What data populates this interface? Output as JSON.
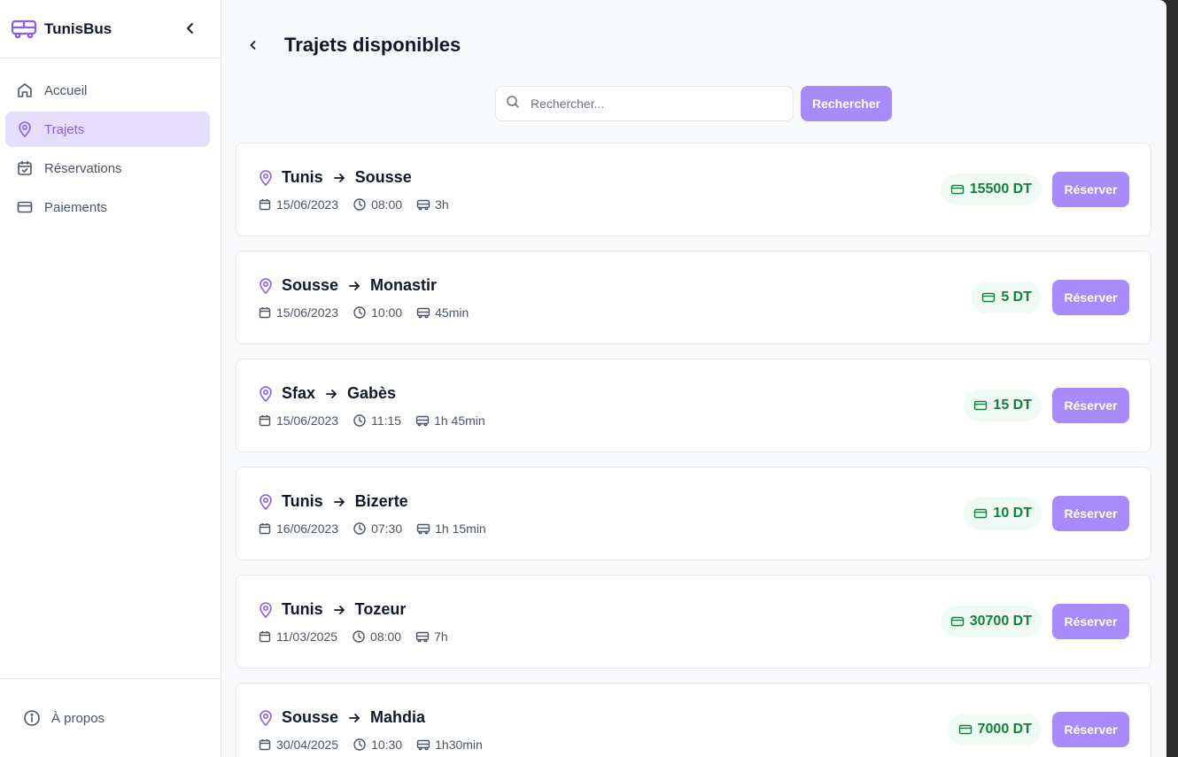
{
  "app": {
    "name": "TunisBus"
  },
  "sidebar": {
    "items": [
      {
        "label": "Accueil",
        "icon": "home-icon",
        "active": false
      },
      {
        "label": "Trajets",
        "icon": "map-pin-icon",
        "active": true
      },
      {
        "label": "Réservations",
        "icon": "calendar-check-icon",
        "active": false
      },
      {
        "label": "Paiements",
        "icon": "credit-card-icon",
        "active": false
      }
    ],
    "footer": {
      "label": "À propos",
      "icon": "info-icon"
    }
  },
  "page": {
    "title": "Trajets disponibles"
  },
  "search": {
    "placeholder": "Rechercher...",
    "button_label": "Rechercher"
  },
  "trips": [
    {
      "from": "Tunis",
      "to": "Sousse",
      "date": "15/06/2023",
      "time": "08:00",
      "duration": "3h",
      "price": "15500 DT",
      "action": "Réserver"
    },
    {
      "from": "Sousse",
      "to": "Monastir",
      "date": "15/06/2023",
      "time": "10:00",
      "duration": "45min",
      "price": "5 DT",
      "action": "Réserver"
    },
    {
      "from": "Sfax",
      "to": "Gabès",
      "date": "15/06/2023",
      "time": "11:15",
      "duration": "1h 45min",
      "price": "15 DT",
      "action": "Réserver"
    },
    {
      "from": "Tunis",
      "to": "Bizerte",
      "date": "16/06/2023",
      "time": "07:30",
      "duration": "1h 15min",
      "price": "10 DT",
      "action": "Réserver"
    },
    {
      "from": "Tunis",
      "to": "Tozeur",
      "date": "11/03/2025",
      "time": "08:00",
      "duration": "7h",
      "price": "30700 DT",
      "action": "Réserver"
    },
    {
      "from": "Sousse",
      "to": "Mahdia",
      "date": "30/04/2025",
      "time": "10:30",
      "duration": "1h30min",
      "price": "7000 DT",
      "action": "Réserver"
    }
  ],
  "colors": {
    "accent": "#a78bfa",
    "accent_text": "#8b5cf6",
    "active_bg": "#e6defd",
    "price_text": "#15803d",
    "price_bg": "#effaf3"
  }
}
